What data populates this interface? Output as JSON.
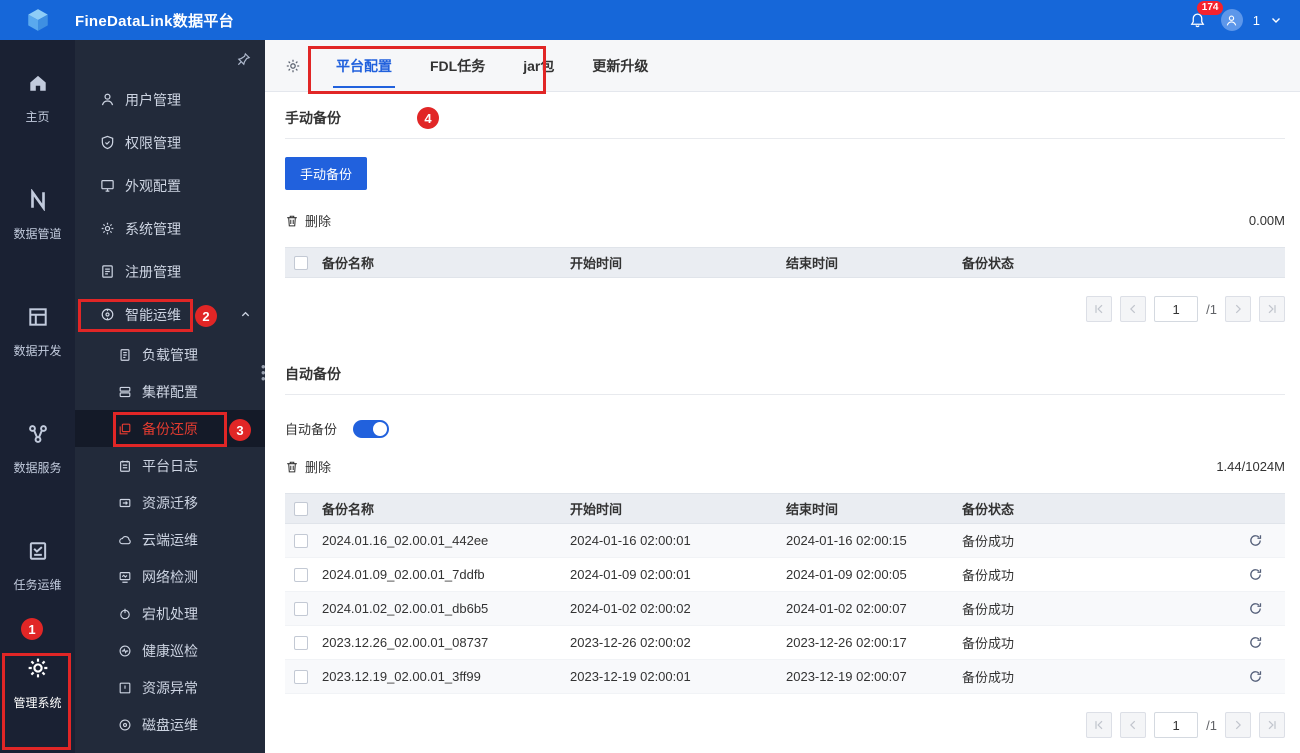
{
  "topbar": {
    "title": "FineDataLink数据平台",
    "notification_badge": "174",
    "user_label": "1"
  },
  "primary_sidebar": {
    "items": [
      {
        "label": "主页"
      },
      {
        "label": "数据管道"
      },
      {
        "label": "数据开发"
      },
      {
        "label": "数据服务"
      },
      {
        "label": "任务运维"
      },
      {
        "label": "管理系统"
      }
    ]
  },
  "secondary_sidebar": {
    "items": [
      {
        "label": "用户管理"
      },
      {
        "label": "权限管理"
      },
      {
        "label": "外观配置"
      },
      {
        "label": "系统管理"
      },
      {
        "label": "注册管理"
      },
      {
        "label": "智能运维"
      }
    ],
    "sub_items": [
      {
        "label": "负载管理"
      },
      {
        "label": "集群配置"
      },
      {
        "label": "备份还原"
      },
      {
        "label": "平台日志"
      },
      {
        "label": "资源迁移"
      },
      {
        "label": "云端运维"
      },
      {
        "label": "网络检测"
      },
      {
        "label": "宕机处理"
      },
      {
        "label": "健康巡检"
      },
      {
        "label": "资源异常"
      },
      {
        "label": "磁盘运维"
      }
    ]
  },
  "tabs": {
    "items": [
      {
        "label": "平台配置"
      },
      {
        "label": "FDL任务"
      },
      {
        "label": "jar包"
      },
      {
        "label": "更新升级"
      }
    ]
  },
  "manual_backup": {
    "title": "手动备份",
    "button_label": "手动备份",
    "delete_label": "删除",
    "size_info": "0.00M",
    "columns": [
      "备份名称",
      "开始时间",
      "结束时间",
      "备份状态"
    ],
    "pagination": {
      "page": "1",
      "total": "/1"
    }
  },
  "auto_backup": {
    "title": "自动备份",
    "toggle_label": "自动备份",
    "delete_label": "删除",
    "size_info": "1.44/1024M",
    "columns": [
      "备份名称",
      "开始时间",
      "结束时间",
      "备份状态"
    ],
    "rows": [
      {
        "name": "2024.01.16_02.00.01_442ee",
        "start": "2024-01-16 02:00:01",
        "end": "2024-01-16 02:00:15",
        "status": "备份成功"
      },
      {
        "name": "2024.01.09_02.00.01_7ddfb",
        "start": "2024-01-09 02:00:01",
        "end": "2024-01-09 02:00:05",
        "status": "备份成功"
      },
      {
        "name": "2024.01.02_02.00.01_db6b5",
        "start": "2024-01-02 02:00:02",
        "end": "2024-01-02 02:00:07",
        "status": "备份成功"
      },
      {
        "name": "2023.12.26_02.00.01_08737",
        "start": "2023-12-26 02:00:02",
        "end": "2023-12-26 02:00:17",
        "status": "备份成功"
      },
      {
        "name": "2023.12.19_02.00.01_3ff99",
        "start": "2023-12-19 02:00:01",
        "end": "2023-12-19 02:00:07",
        "status": "备份成功"
      }
    ],
    "pagination": {
      "page": "1",
      "total": "/1"
    }
  },
  "annotations": {
    "b1": "1",
    "b2": "2",
    "b3": "3",
    "b4": "4"
  },
  "colors": {
    "topbar_blue": "#1667d9",
    "accent_blue": "#2161dd",
    "annotation_red": "#e12626",
    "sidebar_dark": "#1a2133",
    "sidebar_mid": "#222a3a",
    "status_badge_red": "#f5222d"
  }
}
